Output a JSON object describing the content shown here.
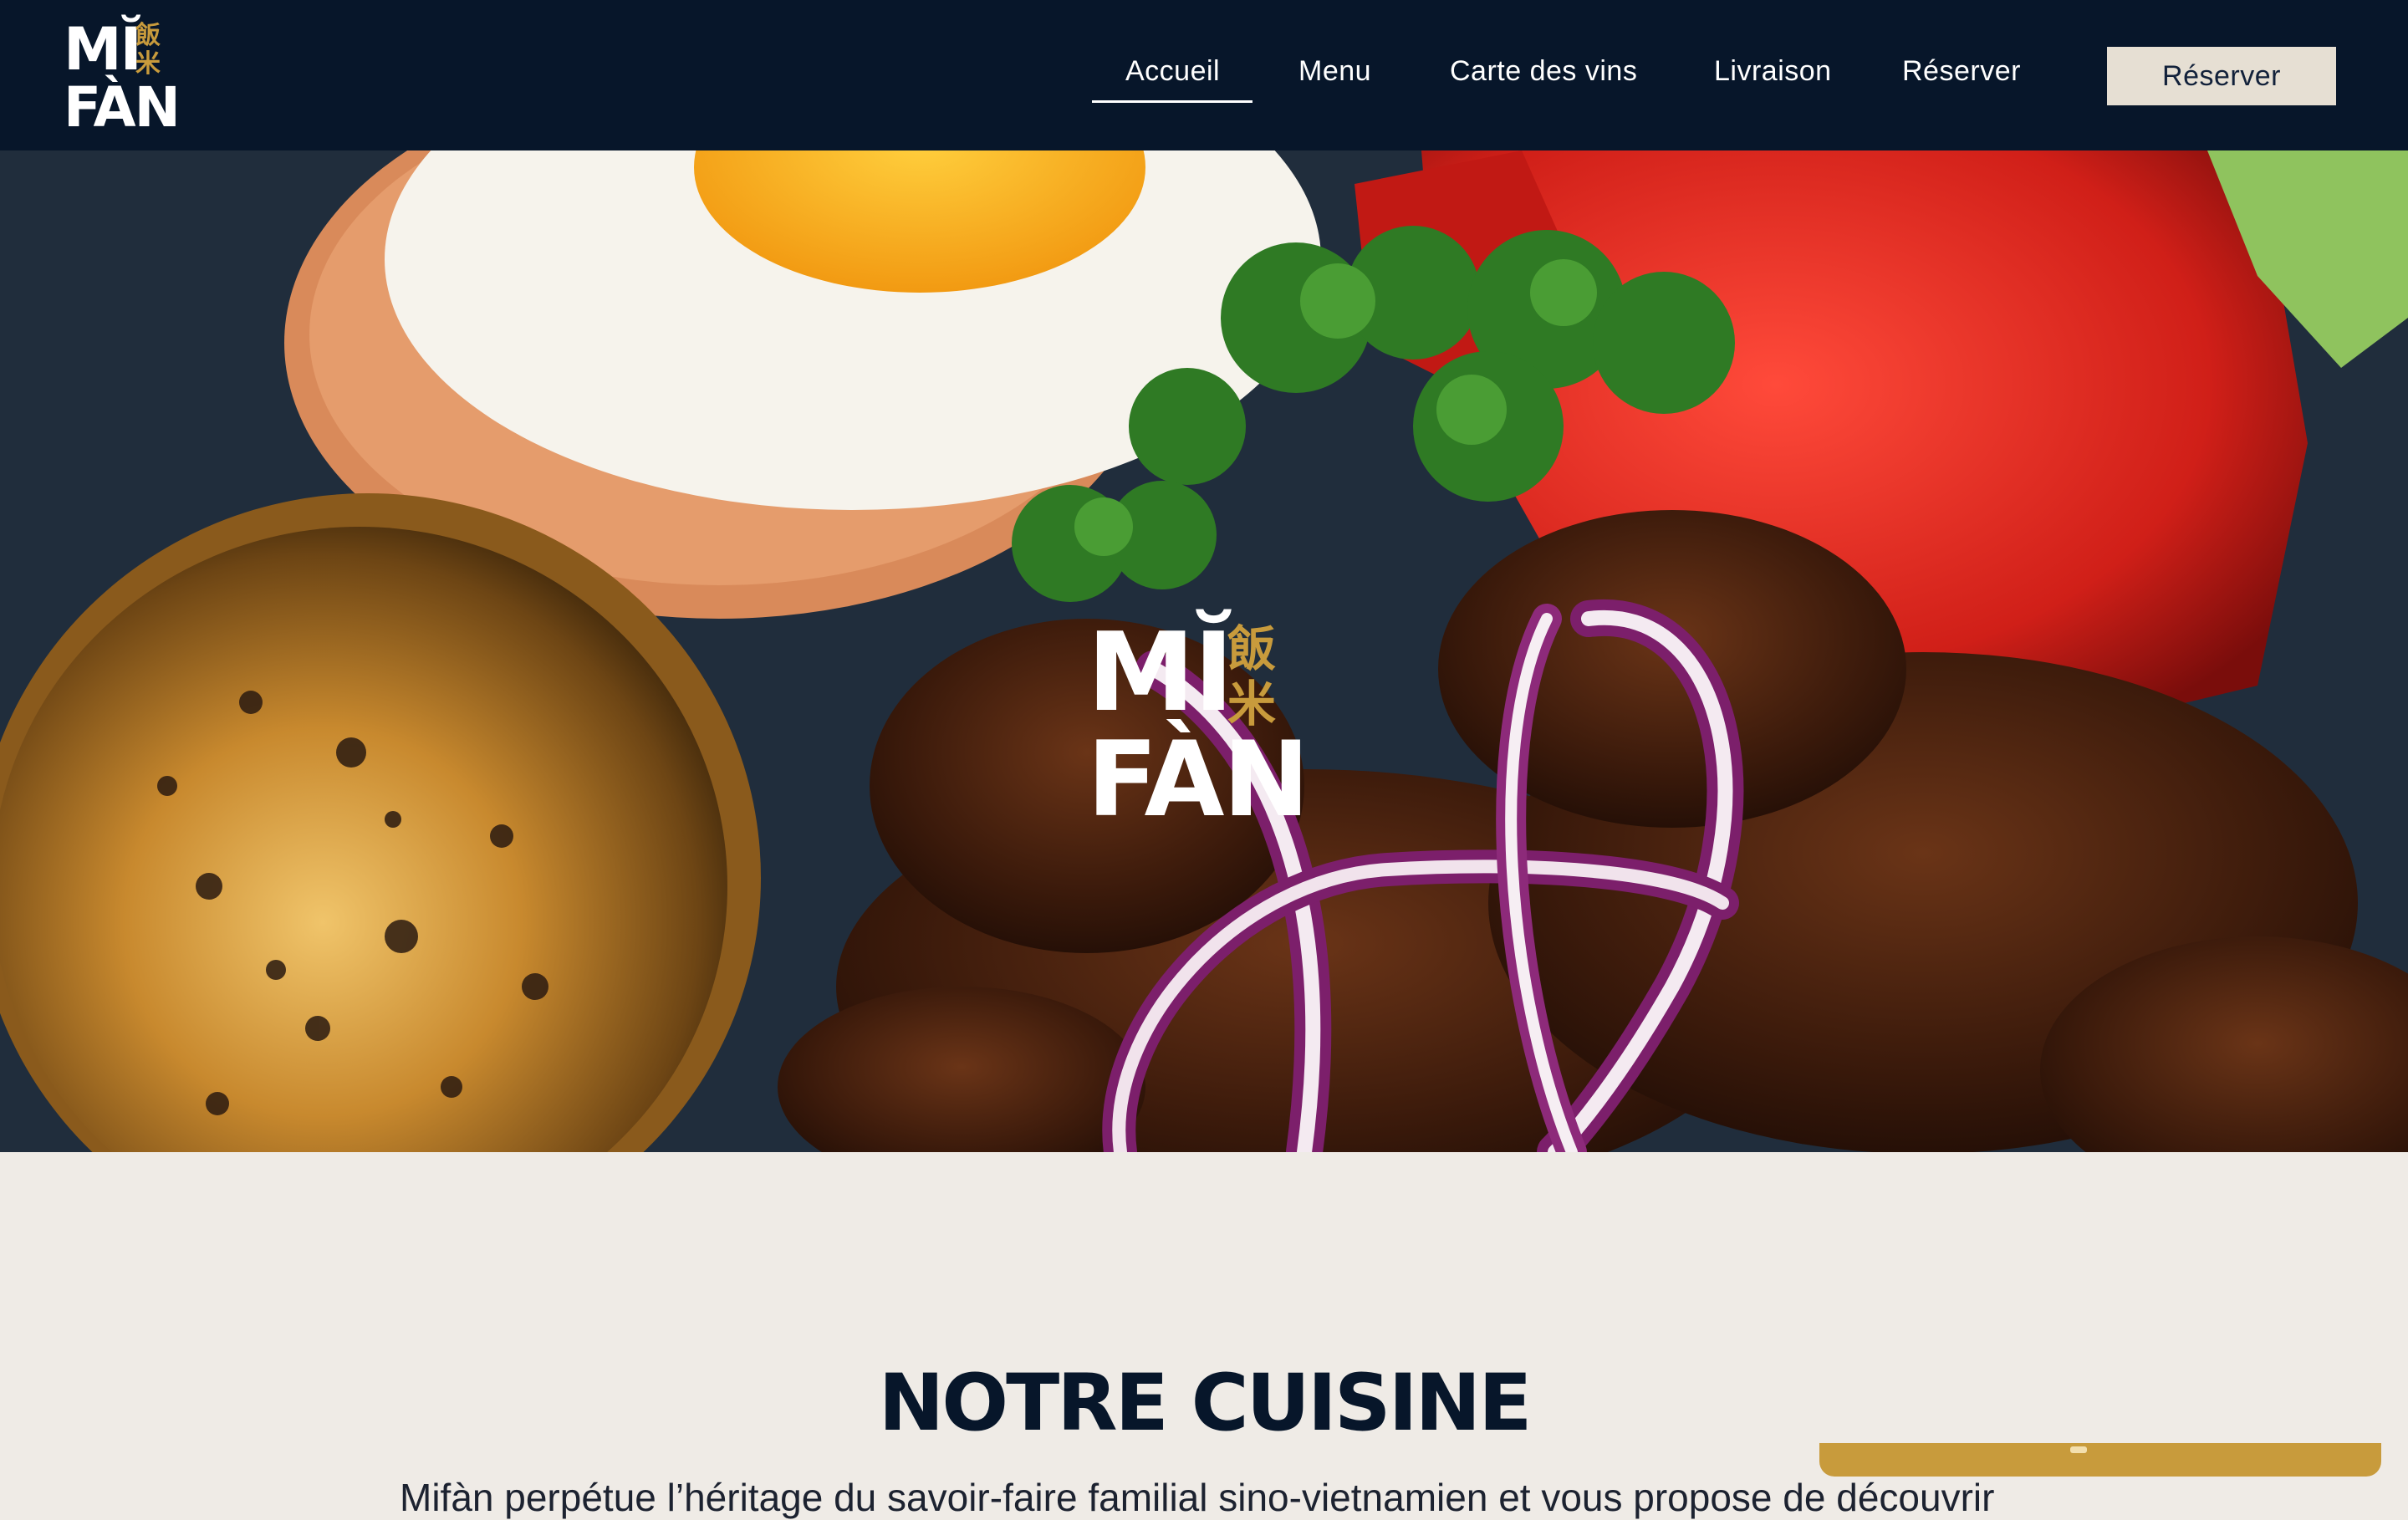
{
  "brand": {
    "logo_line1": "MĬ",
    "logo_line2": "FÀN",
    "logo_cjk_top": "飯",
    "logo_cjk_bottom": "米",
    "accent_color": "#c89b3c",
    "header_color": "#07162a"
  },
  "nav": {
    "items": [
      {
        "label": "Accueil",
        "active": true
      },
      {
        "label": "Menu"
      },
      {
        "label": "Carte des vins"
      },
      {
        "label": "Livraison"
      },
      {
        "label": "Réserver"
      }
    ],
    "cta_label": "Réserver"
  },
  "hero": {
    "image_description": "fried rice with egg, glazed beef, parsley, tomato, red onion, sauce bowl"
  },
  "section": {
    "title": "NOTRE CUISINE",
    "body": "Mifàn perpétue l’héritage du savoir-faire familial sino-vietnamien et vous propose de découvrir"
  }
}
